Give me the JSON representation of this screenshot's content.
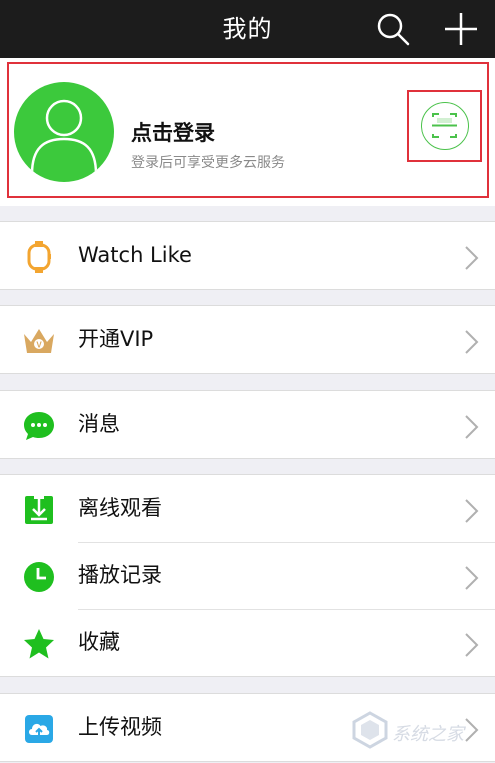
{
  "header": {
    "title": "我的",
    "search_icon": "search-icon",
    "add_icon": "plus-icon"
  },
  "profile": {
    "title": "点击登录",
    "subtitle": "登录后可享受更多云服务",
    "avatar_icon": "default-avatar-icon",
    "scan_icon": "qr-scan-icon"
  },
  "menu": {
    "watch_like": "Watch Like",
    "vip": "开通VIP",
    "messages": "消息",
    "offline": "离线观看",
    "history": "播放记录",
    "favorites": "收藏",
    "upload": "上传视频"
  },
  "watermark": {
    "text": "系统之家"
  },
  "colors": {
    "accent_green": "#3cc93c",
    "highlight_red": "#e0313b",
    "topbar": "#1c1c1c",
    "watch_orange": "#f3a530",
    "vip_gold": "#d9a860",
    "upload_blue": "#2aa8e6"
  }
}
